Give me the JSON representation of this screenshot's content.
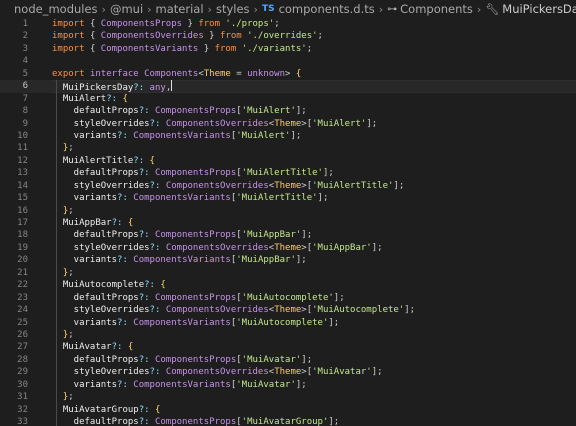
{
  "breadcrumb": {
    "items": [
      "node_modules",
      "@mui",
      "material",
      "styles"
    ],
    "ts_badge": "TS",
    "file": "components.d.ts",
    "symbol1": "Components",
    "symbol2": "MuiPickersDay"
  },
  "editor": {
    "current_line": 6,
    "lines": [
      {
        "n": "1",
        "tokens": [
          [
            "k2",
            "import "
          ],
          [
            "pu",
            "{ "
          ],
          [
            "ty",
            "ComponentsProps"
          ],
          [
            "pu",
            " } "
          ],
          [
            "k2",
            "from "
          ],
          [
            "s",
            "'./props'"
          ],
          [
            "pu",
            ";"
          ]
        ]
      },
      {
        "n": "2",
        "tokens": [
          [
            "k2",
            "import "
          ],
          [
            "pu",
            "{ "
          ],
          [
            "ty",
            "ComponentsOverrides"
          ],
          [
            "pu",
            " } "
          ],
          [
            "k2",
            "from "
          ],
          [
            "s",
            "'./overrides'"
          ],
          [
            "pu",
            ";"
          ]
        ]
      },
      {
        "n": "3",
        "tokens": [
          [
            "k2",
            "import "
          ],
          [
            "pu",
            "{ "
          ],
          [
            "ty",
            "ComponentsVariants"
          ],
          [
            "pu",
            " } "
          ],
          [
            "k2",
            "from "
          ],
          [
            "s",
            "'./variants'"
          ],
          [
            "pu",
            ";"
          ]
        ]
      },
      {
        "n": "4",
        "tokens": []
      },
      {
        "n": "5",
        "tokens": [
          [
            "k2",
            "export "
          ],
          [
            "k",
            "interface "
          ],
          [
            "ty",
            "Components"
          ],
          [
            "pu",
            "<"
          ],
          [
            "tp",
            "Theme"
          ],
          [
            "pu",
            " = "
          ],
          [
            "k",
            "unknown"
          ],
          [
            "pu",
            "> "
          ],
          [
            "b",
            "{"
          ]
        ]
      },
      {
        "n": "6",
        "tokens": [
          [
            "p",
            "  MuiPickersDay"
          ],
          [
            "q",
            "?: "
          ],
          [
            "any",
            "any"
          ],
          [
            "pu",
            ","
          ]
        ]
      },
      {
        "n": "7",
        "tokens": [
          [
            "p",
            "  MuiAlert"
          ],
          [
            "q",
            "?: "
          ],
          [
            "b",
            "{"
          ]
        ]
      },
      {
        "n": "8",
        "tokens": [
          [
            "p",
            "    defaultProps"
          ],
          [
            "q",
            "?: "
          ],
          [
            "ty",
            "ComponentsProps"
          ],
          [
            "pu",
            "["
          ],
          [
            "s",
            "'MuiAlert'"
          ],
          [
            "pu",
            "];"
          ]
        ]
      },
      {
        "n": "9",
        "tokens": [
          [
            "p",
            "    styleOverrides"
          ],
          [
            "q",
            "?: "
          ],
          [
            "ty",
            "ComponentsOverrides"
          ],
          [
            "pu",
            "<"
          ],
          [
            "tp",
            "Theme"
          ],
          [
            "pu",
            ">["
          ],
          [
            "s",
            "'MuiAlert'"
          ],
          [
            "pu",
            "];"
          ]
        ]
      },
      {
        "n": "10",
        "tokens": [
          [
            "p",
            "    variants"
          ],
          [
            "q",
            "?: "
          ],
          [
            "ty",
            "ComponentsVariants"
          ],
          [
            "pu",
            "["
          ],
          [
            "s",
            "'MuiAlert'"
          ],
          [
            "pu",
            "];"
          ]
        ]
      },
      {
        "n": "11",
        "tokens": [
          [
            "b",
            "  }"
          ],
          [
            "pu",
            ";"
          ]
        ]
      },
      {
        "n": "12",
        "tokens": [
          [
            "p",
            "  MuiAlertTitle"
          ],
          [
            "q",
            "?: "
          ],
          [
            "b",
            "{"
          ]
        ]
      },
      {
        "n": "13",
        "tokens": [
          [
            "p",
            "    defaultProps"
          ],
          [
            "q",
            "?: "
          ],
          [
            "ty",
            "ComponentsProps"
          ],
          [
            "pu",
            "["
          ],
          [
            "s",
            "'MuiAlertTitle'"
          ],
          [
            "pu",
            "];"
          ]
        ]
      },
      {
        "n": "14",
        "tokens": [
          [
            "p",
            "    styleOverrides"
          ],
          [
            "q",
            "?: "
          ],
          [
            "ty",
            "ComponentsOverrides"
          ],
          [
            "pu",
            "<"
          ],
          [
            "tp",
            "Theme"
          ],
          [
            "pu",
            ">["
          ],
          [
            "s",
            "'MuiAlertTitle'"
          ],
          [
            "pu",
            "];"
          ]
        ]
      },
      {
        "n": "15",
        "tokens": [
          [
            "p",
            "    variants"
          ],
          [
            "q",
            "?: "
          ],
          [
            "ty",
            "ComponentsVariants"
          ],
          [
            "pu",
            "["
          ],
          [
            "s",
            "'MuiAlertTitle'"
          ],
          [
            "pu",
            "];"
          ]
        ]
      },
      {
        "n": "16",
        "tokens": [
          [
            "b",
            "  }"
          ],
          [
            "pu",
            ";"
          ]
        ]
      },
      {
        "n": "17",
        "tokens": [
          [
            "p",
            "  MuiAppBar"
          ],
          [
            "q",
            "?: "
          ],
          [
            "b",
            "{"
          ]
        ]
      },
      {
        "n": "18",
        "tokens": [
          [
            "p",
            "    defaultProps"
          ],
          [
            "q",
            "?: "
          ],
          [
            "ty",
            "ComponentsProps"
          ],
          [
            "pu",
            "["
          ],
          [
            "s",
            "'MuiAppBar'"
          ],
          [
            "pu",
            "];"
          ]
        ]
      },
      {
        "n": "19",
        "tokens": [
          [
            "p",
            "    styleOverrides"
          ],
          [
            "q",
            "?: "
          ],
          [
            "ty",
            "ComponentsOverrides"
          ],
          [
            "pu",
            "<"
          ],
          [
            "tp",
            "Theme"
          ],
          [
            "pu",
            ">["
          ],
          [
            "s",
            "'MuiAppBar'"
          ],
          [
            "pu",
            "];"
          ]
        ]
      },
      {
        "n": "20",
        "tokens": [
          [
            "p",
            "    variants"
          ],
          [
            "q",
            "?: "
          ],
          [
            "ty",
            "ComponentsVariants"
          ],
          [
            "pu",
            "["
          ],
          [
            "s",
            "'MuiAppBar'"
          ],
          [
            "pu",
            "];"
          ]
        ]
      },
      {
        "n": "21",
        "tokens": [
          [
            "b",
            "  }"
          ],
          [
            "pu",
            ";"
          ]
        ]
      },
      {
        "n": "22",
        "tokens": [
          [
            "p",
            "  MuiAutocomplete"
          ],
          [
            "q",
            "?: "
          ],
          [
            "b",
            "{"
          ]
        ]
      },
      {
        "n": "23",
        "tokens": [
          [
            "p",
            "    defaultProps"
          ],
          [
            "q",
            "?: "
          ],
          [
            "ty",
            "ComponentsProps"
          ],
          [
            "pu",
            "["
          ],
          [
            "s",
            "'MuiAutocomplete'"
          ],
          [
            "pu",
            "];"
          ]
        ]
      },
      {
        "n": "24",
        "tokens": [
          [
            "p",
            "    styleOverrides"
          ],
          [
            "q",
            "?: "
          ],
          [
            "ty",
            "ComponentsOverrides"
          ],
          [
            "pu",
            "<"
          ],
          [
            "tp",
            "Theme"
          ],
          [
            "pu",
            ">["
          ],
          [
            "s",
            "'MuiAutocomplete'"
          ],
          [
            "pu",
            "];"
          ]
        ]
      },
      {
        "n": "25",
        "tokens": [
          [
            "p",
            "    variants"
          ],
          [
            "q",
            "?: "
          ],
          [
            "ty",
            "ComponentsVariants"
          ],
          [
            "pu",
            "["
          ],
          [
            "s",
            "'MuiAutocomplete'"
          ],
          [
            "pu",
            "];"
          ]
        ]
      },
      {
        "n": "26",
        "tokens": [
          [
            "b",
            "  }"
          ],
          [
            "pu",
            ";"
          ]
        ]
      },
      {
        "n": "27",
        "tokens": [
          [
            "p",
            "  MuiAvatar"
          ],
          [
            "q",
            "?: "
          ],
          [
            "b",
            "{"
          ]
        ]
      },
      {
        "n": "28",
        "tokens": [
          [
            "p",
            "    defaultProps"
          ],
          [
            "q",
            "?: "
          ],
          [
            "ty",
            "ComponentsProps"
          ],
          [
            "pu",
            "["
          ],
          [
            "s",
            "'MuiAvatar'"
          ],
          [
            "pu",
            "];"
          ]
        ]
      },
      {
        "n": "29",
        "tokens": [
          [
            "p",
            "    styleOverrides"
          ],
          [
            "q",
            "?: "
          ],
          [
            "ty",
            "ComponentsOverrides"
          ],
          [
            "pu",
            "<"
          ],
          [
            "tp",
            "Theme"
          ],
          [
            "pu",
            ">["
          ],
          [
            "s",
            "'MuiAvatar'"
          ],
          [
            "pu",
            "];"
          ]
        ]
      },
      {
        "n": "30",
        "tokens": [
          [
            "p",
            "    variants"
          ],
          [
            "q",
            "?: "
          ],
          [
            "ty",
            "ComponentsVariants"
          ],
          [
            "pu",
            "["
          ],
          [
            "s",
            "'MuiAvatar'"
          ],
          [
            "pu",
            "];"
          ]
        ]
      },
      {
        "n": "31",
        "tokens": [
          [
            "b",
            "  }"
          ],
          [
            "pu",
            ";"
          ]
        ]
      },
      {
        "n": "32",
        "tokens": [
          [
            "p",
            "  MuiAvatarGroup"
          ],
          [
            "q",
            "?: "
          ],
          [
            "b",
            "{"
          ]
        ]
      },
      {
        "n": "33",
        "tokens": [
          [
            "p",
            "    defaultProps"
          ],
          [
            "q",
            "?: "
          ],
          [
            "ty",
            "ComponentsProps"
          ],
          [
            "pu",
            "["
          ],
          [
            "s",
            "'MuiAvatarGroup'"
          ],
          [
            "pu",
            "];"
          ]
        ]
      }
    ]
  }
}
